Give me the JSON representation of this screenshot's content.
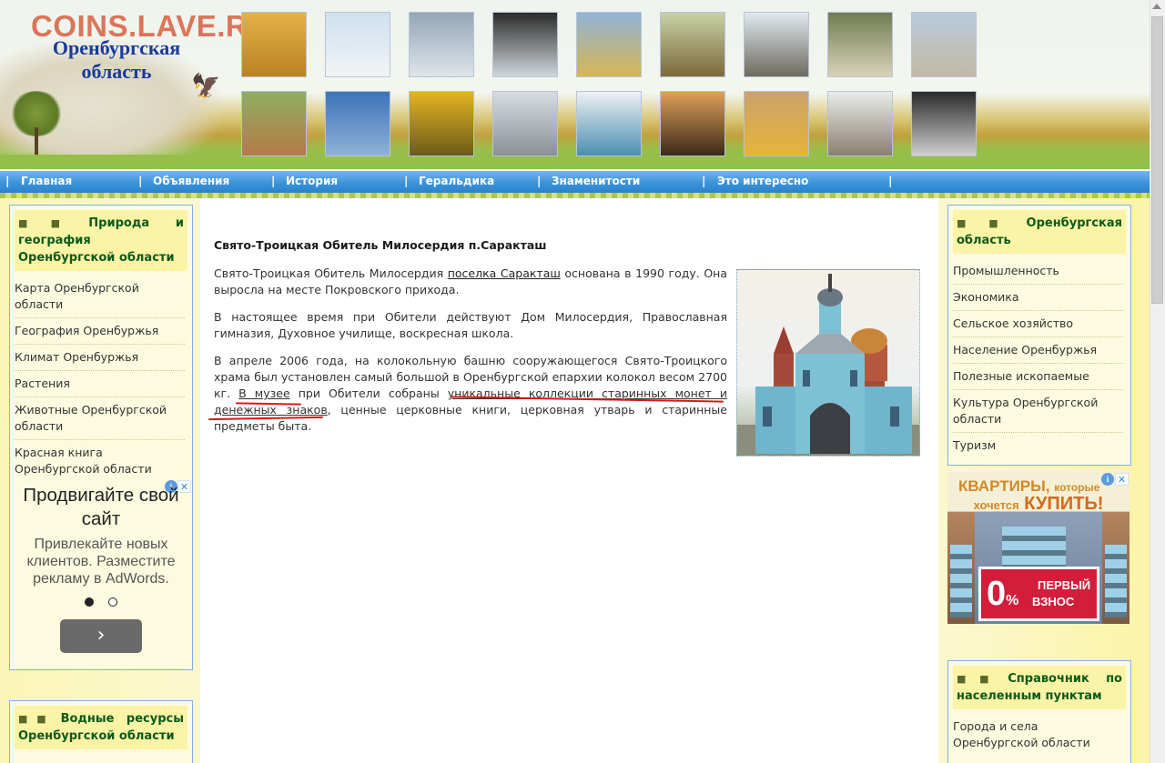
{
  "header": {
    "site_brand": "COINS.LAVE.RU",
    "region_title": "Оренбургская область",
    "thumbnails": [
      {
        "name": "wheat",
        "color_top": "#e3b24a",
        "color_bottom": "#b9821f"
      },
      {
        "name": "shawl-woman",
        "color_top": "#cfe0ef",
        "color_bottom": "#f1f4f6"
      },
      {
        "name": "swan",
        "color_top": "#93a6b7",
        "color_bottom": "#dfe5ea"
      },
      {
        "name": "salt-crystals",
        "color_top": "#2b2b2b",
        "color_bottom": "#cfd7dc"
      },
      {
        "name": "steppe-field",
        "color_top": "#8fb4d6",
        "color_bottom": "#d7b653"
      },
      {
        "name": "hunter",
        "color_top": "#c8d2a6",
        "color_bottom": "#7b6a3a"
      },
      {
        "name": "cathedral",
        "color_top": "#dfe9f0",
        "color_bottom": "#6f6a5e"
      },
      {
        "name": "tulips",
        "color_top": "#6f7c52",
        "color_bottom": "#d9d3b8"
      },
      {
        "name": "mosque",
        "color_top": "#b9ccde",
        "color_bottom": "#c3b9a5"
      },
      {
        "name": "cow",
        "color_top": "#8fae62",
        "color_bottom": "#b57a46"
      },
      {
        "name": "oil-pump",
        "color_top": "#3d73b9",
        "color_bottom": "#8fb2d8"
      },
      {
        "name": "sunflowers",
        "color_top": "#e4b421",
        "color_bottom": "#6b5a1a"
      },
      {
        "name": "city-model",
        "color_top": "#d8dde2",
        "color_bottom": "#8a9097"
      },
      {
        "name": "church-blue",
        "color_top": "#eef1f3",
        "color_bottom": "#4a8fb0"
      },
      {
        "name": "camel",
        "color_top": "#e0a05a",
        "color_bottom": "#3a2a1a"
      },
      {
        "name": "cheese",
        "color_top": "#caa26a",
        "color_bottom": "#e6b43a"
      },
      {
        "name": "stone-stacks",
        "color_top": "#e9ece9",
        "color_bottom": "#8b7f70"
      },
      {
        "name": "lace-shawl",
        "color_top": "#2a2a2a",
        "color_bottom": "#cfcfcf"
      }
    ]
  },
  "nav": {
    "items": [
      {
        "label": "Главная"
      },
      {
        "label": "Объявления"
      },
      {
        "label": "История"
      },
      {
        "label": "Геральдика"
      },
      {
        "label": "Знаменитости"
      },
      {
        "label": "Это интересно"
      }
    ],
    "separator": "|"
  },
  "left_sidebar": {
    "box1": {
      "title": "Природа и география Оренбургской области",
      "items": [
        {
          "label": "Карта Оренбургской области"
        },
        {
          "label": "География Оренбуржья"
        },
        {
          "label": "Климат Оренбуржья"
        },
        {
          "label": "Растения"
        },
        {
          "label": "Животные Оренбургской области"
        },
        {
          "label": "Красная книга Оренбургской области"
        }
      ]
    },
    "ad": {
      "headline": "Продвигайте свой сайт",
      "text": "Привлекайте новых клиентов. Разместите рекламу в AdWords.",
      "next_glyph": "›",
      "close_glyph": "✕",
      "info_glyph": "i"
    },
    "box2": {
      "title": "Водные ресурсы Оренбургской области"
    }
  },
  "right_sidebar": {
    "box1": {
      "title": "Оренбургская область",
      "items": [
        {
          "label": "Промышленность"
        },
        {
          "label": "Экономика"
        },
        {
          "label": "Сельское хозяйство"
        },
        {
          "label": "Население Оренбуржья"
        },
        {
          "label": "Полезные ископаемые"
        },
        {
          "label": "Культура Оренбургской области"
        },
        {
          "label": "Туризм"
        }
      ]
    },
    "ad": {
      "line1_a": "КВАРТИРЫ,",
      "line1_b": "которые",
      "line2_a": "хочется",
      "line2_b": "КУПИТЬ!",
      "promo_big": "0",
      "promo_pct": "%",
      "promo_line1": "ПЕРВЫЙ",
      "promo_line2": "ВЗНОС",
      "close_glyph": "✕",
      "info_glyph": "i"
    },
    "box2": {
      "title": "Справочник по населенным пунктам",
      "items": [
        {
          "label": "Города и села Оренбургской области"
        }
      ]
    }
  },
  "article": {
    "title": "Свято-Троицкая Обитель Милосердия п.Саракташ",
    "p1_before": "Свято-Троицкая Обитель Милосердия ",
    "p1_link": "поселка Саракташ",
    "p1_after": " основана в 1990 году. Она выросла на месте Покровского прихода.",
    "p2": "В настоящее время при Обители действуют Дом Милосердия, Православная гимназия, Духовное училище, воскресная школа.",
    "p3_a": "В апреле 2006 года, на колокольную башню сооружающегося Свято-Троицкого храма был установлен самый большой в Оренбургской епархии колокол весом 2700 кг. ",
    "p3_u1": "В музее",
    "p3_b": " при Обители собраны ",
    "p3_u2": "уникальные коллекции старинных монет и денежных знаков",
    "p3_c": ", ценные церковные книги, церковная утварь и старинные предметы быта."
  },
  "colors": {
    "nav_bg": "#3b93da",
    "sidebar_bg": "#fbf8cf",
    "box_title_text": "#0b5a1a",
    "annotation_red": "#d81818"
  }
}
